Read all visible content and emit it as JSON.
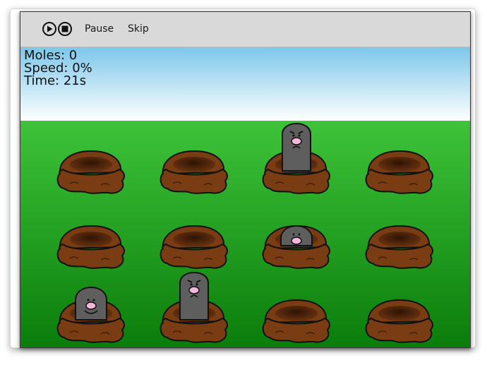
{
  "toolbar": {
    "play_icon": "play-circle-icon",
    "stop_icon": "stop-circle-icon",
    "pause_label": "Pause",
    "skip_label": "Skip"
  },
  "hud": {
    "moles": "Moles: 0",
    "speed": "Speed: 0%",
    "time": "Time: 21s"
  },
  "colors": {
    "toolbar": "#d9d9d9",
    "sky_top": "#7cc7ea",
    "sky_bottom": "#ffffff",
    "grass_top": "#3ec33a",
    "grass_bottom": "#0a7d0a",
    "dirt": "#7a3c12",
    "mole": "#5e5e5e",
    "nose": "#f4b6dd"
  },
  "grid": {
    "rows": 3,
    "cols": 4,
    "holes": [
      {
        "row": 0,
        "col": 0,
        "mole": "none"
      },
      {
        "row": 0,
        "col": 1,
        "mole": "none"
      },
      {
        "row": 0,
        "col": 2,
        "mole": "full-angry"
      },
      {
        "row": 0,
        "col": 3,
        "mole": "none"
      },
      {
        "row": 1,
        "col": 0,
        "mole": "none"
      },
      {
        "row": 1,
        "col": 1,
        "mole": "none"
      },
      {
        "row": 1,
        "col": 2,
        "mole": "peek"
      },
      {
        "row": 1,
        "col": 3,
        "mole": "none"
      },
      {
        "row": 2,
        "col": 0,
        "mole": "half-happy"
      },
      {
        "row": 2,
        "col": 1,
        "mole": "full-angry"
      },
      {
        "row": 2,
        "col": 2,
        "mole": "none"
      },
      {
        "row": 2,
        "col": 3,
        "mole": "none"
      }
    ]
  }
}
